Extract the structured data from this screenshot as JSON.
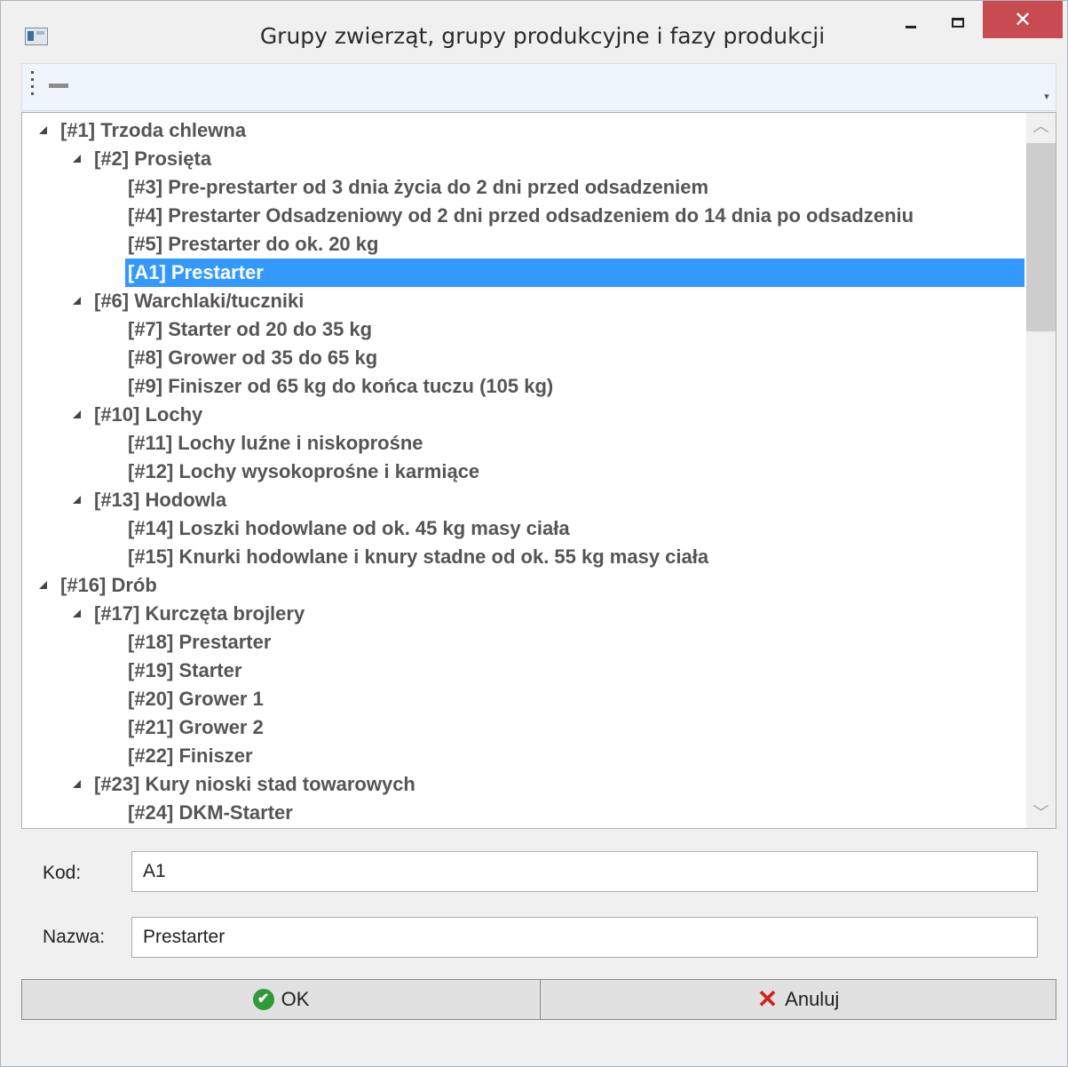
{
  "window": {
    "title": "Grupy zwierząt, grupy produkcyjne i fazy produkcji",
    "close_glyph": "✕"
  },
  "toolbar": {
    "overflow_glyph": "▾"
  },
  "tree": {
    "items": [
      {
        "label": "[#1] Trzoda chlewna",
        "level": 0,
        "expanded": true
      },
      {
        "label": "[#2] Prosięta",
        "level": 1,
        "expanded": true
      },
      {
        "label": "[#3] Pre-prestarter od 3 dnia życia do 2 dni przed odsadzeniem",
        "level": 2
      },
      {
        "label": "[#4] Prestarter Odsadzeniowy od 2 dni przed odsadzeniem do 14 dnia po odsadzeniu",
        "level": 2
      },
      {
        "label": "[#5] Prestarter do ok. 20 kg",
        "level": 2
      },
      {
        "label": "[A1] Prestarter",
        "level": 2,
        "selected": true
      },
      {
        "label": "[#6] Warchlaki/tuczniki",
        "level": 1,
        "expanded": true
      },
      {
        "label": "[#7] Starter od 20 do 35 kg",
        "level": 2
      },
      {
        "label": "[#8] Grower od 35 do 65 kg",
        "level": 2
      },
      {
        "label": "[#9] Finiszer od 65 kg do końca tuczu (105 kg)",
        "level": 2
      },
      {
        "label": "[#10] Lochy",
        "level": 1,
        "expanded": true
      },
      {
        "label": "[#11] Lochy luźne i niskoprośne",
        "level": 2
      },
      {
        "label": "[#12] Lochy wysokoprośne i karmiące",
        "level": 2
      },
      {
        "label": "[#13] Hodowla",
        "level": 1,
        "expanded": true
      },
      {
        "label": "[#14] Loszki hodowlane od ok. 45 kg masy ciała",
        "level": 2
      },
      {
        "label": "[#15] Knurki hodowlane i knury stadne od ok. 55 kg masy ciała",
        "level": 2
      },
      {
        "label": "[#16] Drób",
        "level": 0,
        "expanded": true
      },
      {
        "label": "[#17] Kurczęta brojlery",
        "level": 1,
        "expanded": true
      },
      {
        "label": "[#18] Prestarter",
        "level": 2
      },
      {
        "label": "[#19] Starter",
        "level": 2
      },
      {
        "label": "[#20] Grower 1",
        "level": 2
      },
      {
        "label": "[#21] Grower 2",
        "level": 2
      },
      {
        "label": "[#22] Finiszer",
        "level": 2
      },
      {
        "label": "[#23] Kury nioski stad towarowych",
        "level": 1,
        "expanded": true
      },
      {
        "label": "[#24] DKM-Starter",
        "level": 2
      }
    ],
    "scroll_up_glyph": "︿",
    "scroll_down_glyph": "﹀"
  },
  "form": {
    "code_label": "Kod:",
    "code_value": "A1",
    "name_label": "Nazwa:",
    "name_value": "Prestarter"
  },
  "buttons": {
    "ok_label": "OK",
    "ok_glyph": "✔",
    "cancel_label": "Anuluj",
    "cancel_glyph": "✕"
  },
  "colors": {
    "selection": "#3399ff",
    "close_button": "#c74b50",
    "ok_icon": "#2f9a3a",
    "cancel_icon": "#d0211c"
  }
}
